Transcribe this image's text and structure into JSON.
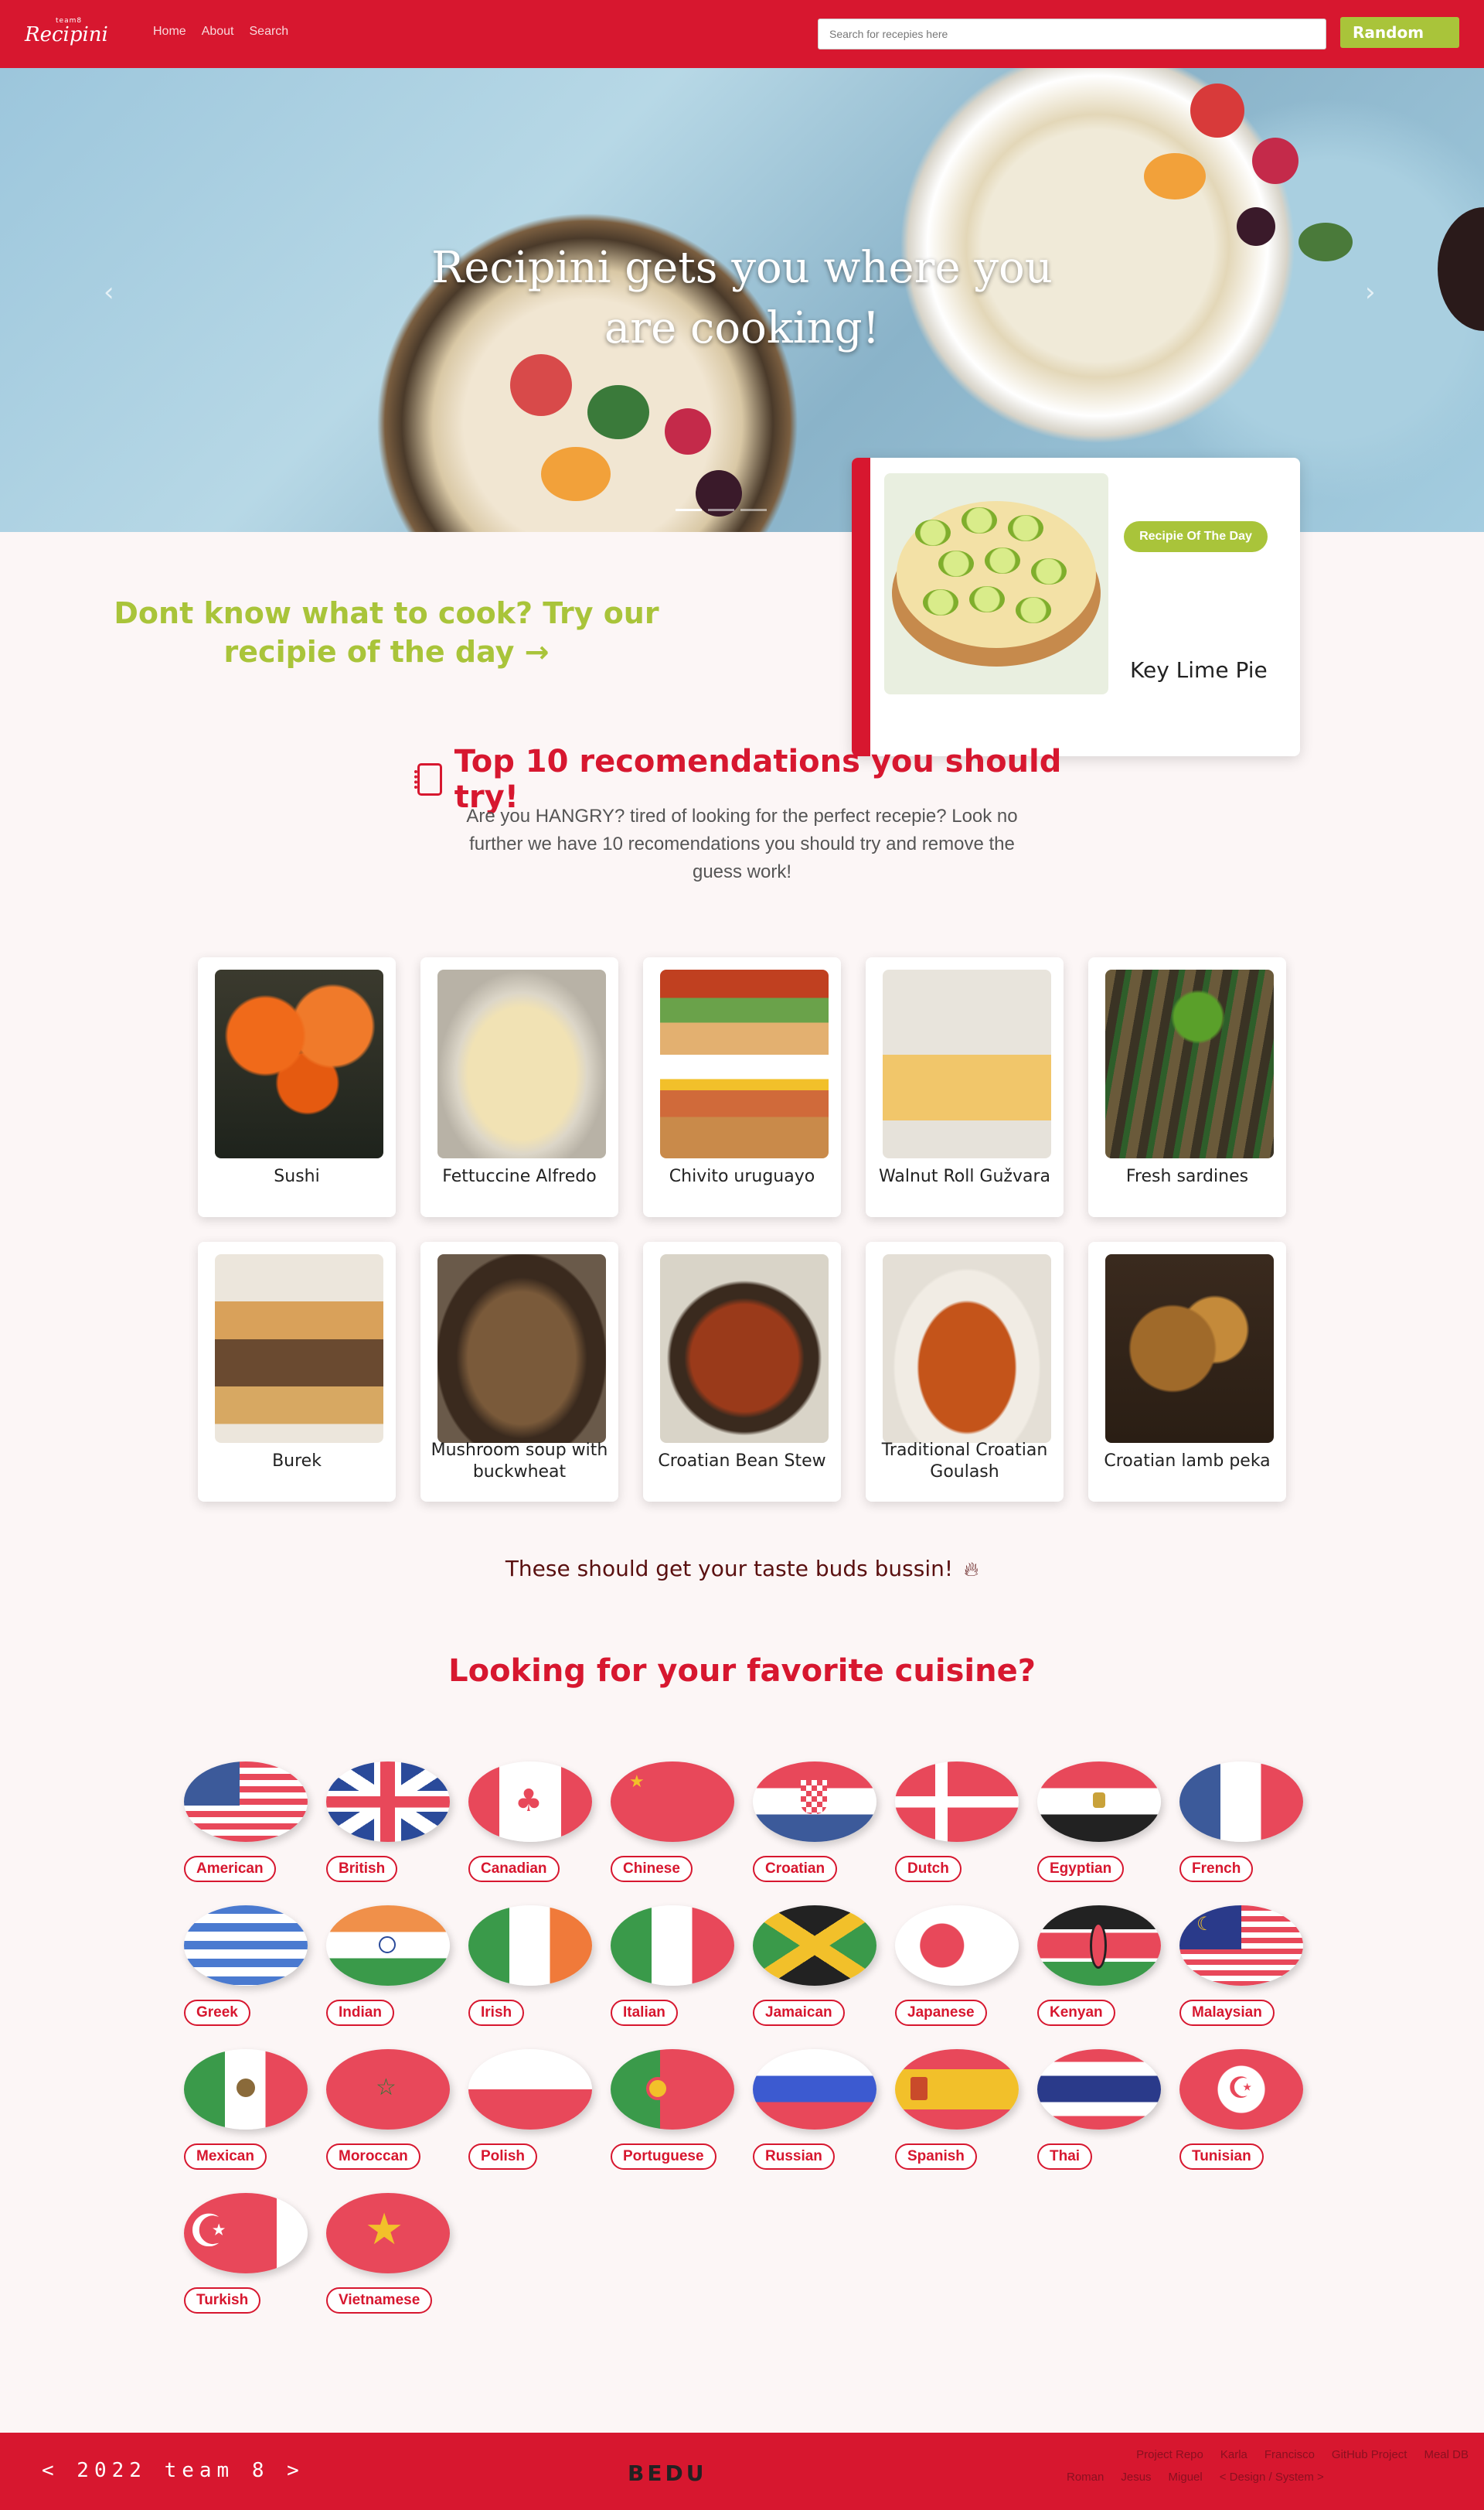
{
  "nav": {
    "logo_small": "team8",
    "logo_main": "Recipini",
    "links": [
      "Home",
      "About",
      "Search"
    ],
    "search_placeholder": "Search for recepies here",
    "random_label": "Random"
  },
  "hero": {
    "title": "Recipini gets you where you are cooking!",
    "prev": "‹",
    "next": "›"
  },
  "recipe_of_day": {
    "cta": "Dont know what to cook? Try our recipie of the day →",
    "badge": "Recipie Of The Day",
    "name": "Key Lime Pie"
  },
  "top10": {
    "heading": "Top 10 recomendations you should try!",
    "description": "Are you HANGRY? tired of looking for the perfect recepie? Look no further we have 10 recomendations you should try and remove the guess work!",
    "items": [
      {
        "name": "Sushi"
      },
      {
        "name": "Fettuccine Alfredo"
      },
      {
        "name": "Chivito uruguayo"
      },
      {
        "name": "Walnut Roll Gužvara"
      },
      {
        "name": "Fresh sardines"
      },
      {
        "name": "Burek"
      },
      {
        "name": "Mushroom soup with buckwheat"
      },
      {
        "name": "Croatian Bean Stew"
      },
      {
        "name": "Traditional Croatian Goulash"
      },
      {
        "name": "Croatian lamb peka"
      }
    ],
    "bussin": "These should get your taste buds bussin!"
  },
  "cuisine": {
    "heading": "Looking for your favorite cuisine?",
    "items": [
      {
        "label": "American"
      },
      {
        "label": "British"
      },
      {
        "label": "Canadian"
      },
      {
        "label": "Chinese"
      },
      {
        "label": "Croatian"
      },
      {
        "label": "Dutch"
      },
      {
        "label": "Egyptian"
      },
      {
        "label": "French"
      },
      {
        "label": "Greek"
      },
      {
        "label": "Indian"
      },
      {
        "label": "Irish"
      },
      {
        "label": "Italian"
      },
      {
        "label": "Jamaican"
      },
      {
        "label": "Japanese"
      },
      {
        "label": "Kenyan"
      },
      {
        "label": "Malaysian"
      },
      {
        "label": "Mexican"
      },
      {
        "label": "Moroccan"
      },
      {
        "label": "Polish"
      },
      {
        "label": "Portuguese"
      },
      {
        "label": "Russian"
      },
      {
        "label": "Spanish"
      },
      {
        "label": "Thai"
      },
      {
        "label": "Tunisian"
      },
      {
        "label": "Turkish"
      },
      {
        "label": "Vietnamese"
      }
    ]
  },
  "footer": {
    "left": "< 2022 team 8 >",
    "logo": "BEDU",
    "links_row1": [
      "Project Repo",
      "Karla",
      "Francisco",
      "GitHub Project",
      "Meal DB"
    ],
    "links_row2": [
      "Roman",
      "Jesus",
      "Miguel",
      "< Design / System >"
    ]
  },
  "colors": {
    "brand_red": "#d7172f",
    "accent_green": "#a9c43a",
    "background": "#fcf6f6"
  }
}
